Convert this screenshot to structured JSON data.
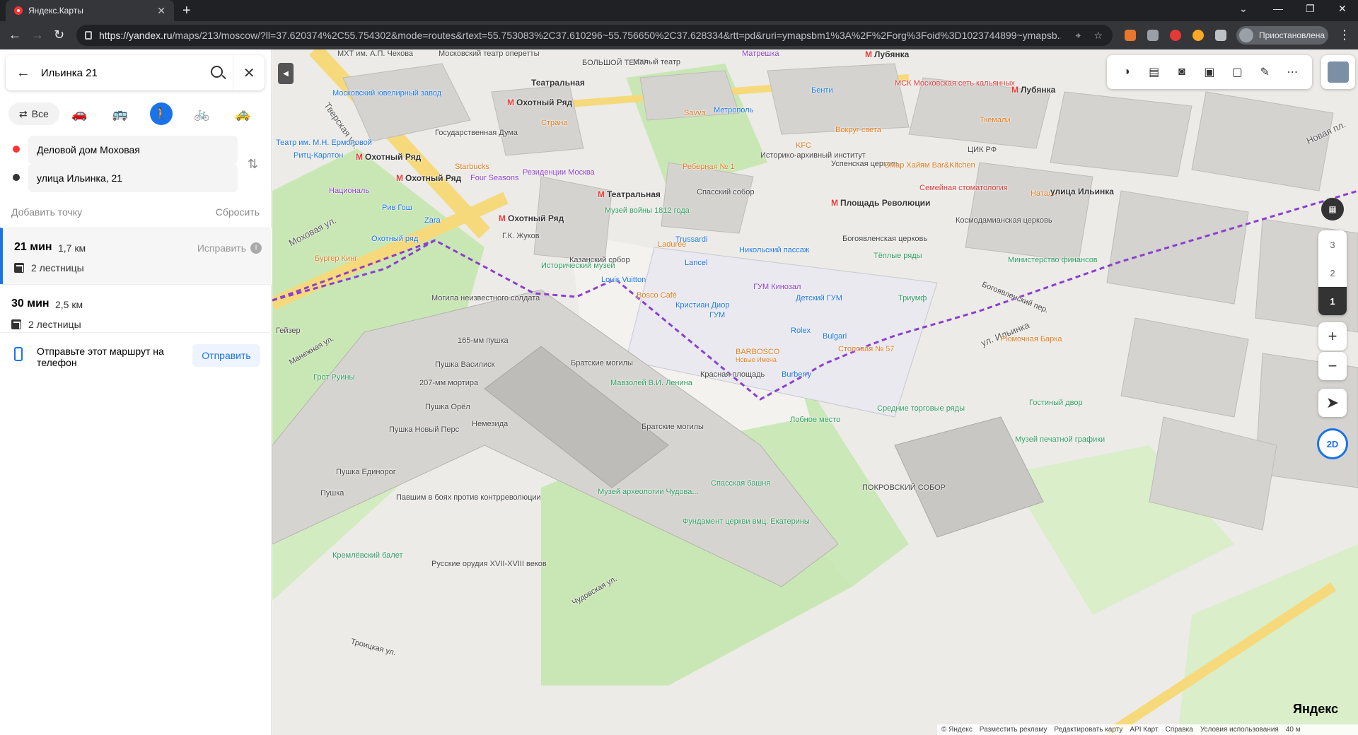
{
  "browser": {
    "tab_title": "Яндекс.Карты",
    "tab_close": "✕",
    "new_tab": "+",
    "url_host": "https://yandex.ru",
    "url_path": "/maps/213/moscow/?ll=37.620374%2C55.754302&mode=routes&rtext=55.753083%2C37.610296~55.756650%2C37.628334&rtt=pd&ruri=ymapsbm1%3A%2F%2Forg%3Foid%3D1023744899~ymapsb...",
    "profile_label": "Приостановлена",
    "window_controls": [
      "—",
      "❐",
      "✕"
    ]
  },
  "sidebar": {
    "search_value": "Ильинка 21",
    "modes": {
      "all_label": "Все"
    },
    "point_a": "Деловой дом Моховая",
    "point_b": "улица Ильинка, 21",
    "add_point": "Добавить точку",
    "reset": "Сбросить",
    "routes": [
      {
        "time": "21 мин",
        "distance": "1,7 км",
        "fix": "Исправить",
        "stairs": "2 лестницы"
      },
      {
        "time": "30 мин",
        "distance": "2,5 км",
        "stairs": "2 лестницы"
      }
    ],
    "send_text": "Отправьте этот маршрут на телефон",
    "send_button": "Отправить"
  },
  "map": {
    "floors": [
      "3",
      "2",
      "1"
    ],
    "zoom_in": "+",
    "zoom_out": "−",
    "mode_2d": "2D",
    "logo_text": "Яндекс",
    "destination_label": "улица Ильинка",
    "scale": "40 м",
    "footer": [
      "© Яндекс",
      "Разместить рекламу",
      "Редактировать карту",
      "API Карт",
      "Справка",
      "Условия использования"
    ],
    "labels": {
      "okhotny_ryad_1": "Охотный Ряд",
      "okhotny_ryad_2": "Охотный Ряд",
      "okhotny_ryad_3": "Охотный Ряд",
      "okhotny_ryad_4": "Охотный Ряд",
      "teatralnaya_1": "Театральная",
      "teatralnaya_2": "Театральная",
      "ploshchad_revolyutsii": "Площадь Революции",
      "lubyanka_1": "Лубянка",
      "lubyanka_2": "Лубянка",
      "tverskaya": "Тверская ул.",
      "mokhovaya": "Моховая ул.",
      "ilyinka": "ул. Ильинка",
      "novaya_pl": "Новая пл.",
      "bolshoy": "БОЛЬШОЙ ТЕАТР",
      "maly": "Малый театр",
      "gos_duma": "Государственная Дума",
      "ritz": "Ритц-Карлтон",
      "natsional": "Националь",
      "four_seasons": "Four Seasons",
      "starbucks": "Starbucks",
      "residentsii": "Резиденции Москва",
      "riv_gosh": "Рив Гош",
      "zara": "Zara",
      "okhotny_ryad_mall": "Охотный ряд",
      "burger_king": "Бургер Кинг",
      "zhukov": "Г.К. Жуков",
      "ist_muzey": "Исторический музей",
      "muzey_voyny": "Музей войны 1812 года",
      "kazansky": "Казанский собор",
      "laduree": "Ladurée",
      "trussardi": "Trussardi",
      "lancel": "Lancel",
      "louis_vuitton": "Louis Vuitton",
      "bosco_cafe": "Bosco Café",
      "christian_dior": "Кристиан Диор",
      "gum": "ГУМ",
      "gum_kinozal": "ГУМ Кинозал",
      "detsky_gum": "Детский ГУМ",
      "rolex": "Rolex",
      "bulgari": "Bulgari",
      "stolovaya": "Столовая № 57",
      "barbosco": "BARBOSCO",
      "barbosco_sub": "Новые Имена",
      "burberry": "Burberry",
      "krasnaya_pl": "Красная площадь",
      "mogila": "Могила неизвестного солдата",
      "grot": "Грот Руины",
      "geyzer": "Гейзер",
      "bratskie_1": "Братские могилы",
      "bratskie_2": "Братские могилы",
      "mavzoley": "Мавзолей В.И. Ленина",
      "lobnoe": "Лобное место",
      "spasskaya": "Спасская башня",
      "pokrovsky": "ПОКРОВСКИЙ СОБОР",
      "srednie": "Средние торговые ряды",
      "nemezida": "Немезида",
      "pushka_vasiliy": "Пушка Василиск",
      "mortira": "207-мм мортира",
      "pushka_orel": "Пушка Орёл",
      "pushka_novy_pers": "Пушка Новый Перс",
      "pushka_edinorog": "Пушка Единорог",
      "pushka": "Пушка",
      "pushka_165": "165-мм пушка",
      "pavshim": "Павшим в боях против контрреволюции",
      "troitskaya": "Троицкая ул.",
      "chudovskaya": "Чудовская ул.",
      "manezhnaya": "Манежная ул.",
      "muzey_arkh": "Музей археологии Чудова...",
      "fundament": "Фундамент церкви вмц. Екатерины",
      "kremlevsky_balet": "Кремлёвский балет",
      "russkie_orudiya": "Русские орудия XVII-XVIII веков",
      "rebernaya": "Реберная № 1",
      "spassky_sobor": "Спасский собор",
      "istoriko_arkh": "Историко-архивный институт",
      "kfc": "KFC",
      "uspenskaya": "Успенская церковь",
      "omar": "Омар Хайям Bar&Kitchen",
      "semeynaya": "Семейная стоматология",
      "tsik_rf": "ЦИК РФ",
      "kosmodamianskaya": "Космодамианская церковь",
      "bogoyavlenskaya": "Богоявленская церковь",
      "nikolsky": "Никольский пассаж",
      "teplye": "Тёплые ряды",
      "triumf": "Триумф",
      "ministerstvo": "Министерство финансов",
      "ryumochnaya": "Рюмочная Барка",
      "gostiny": "Гостиный двор",
      "muzey_pechat": "Музей печатной графики",
      "bogoyavlensky_per": "Богоявленский пер.",
      "vokrug_sveta": "Вокруг света",
      "msk_moskov": "МСК Московская сеть кальянных",
      "benti": "Бенти",
      "tkemali": "Ткемали",
      "metropol": "Метрополь",
      "savva": "Savva",
      "strana": "Страна",
      "matreshka": "Матрешка",
      "mkht": "МХТ им. А.П. Чехова",
      "teatr_operetty": "Московский театр оперетты",
      "yuvelirny": "Московский ювелирный завод",
      "teatr_ermolova": "Театр им. М.Н. Ермоловой",
      "lubyanka_pr": "Лубянка",
      "nataly": "Натали"
    }
  }
}
